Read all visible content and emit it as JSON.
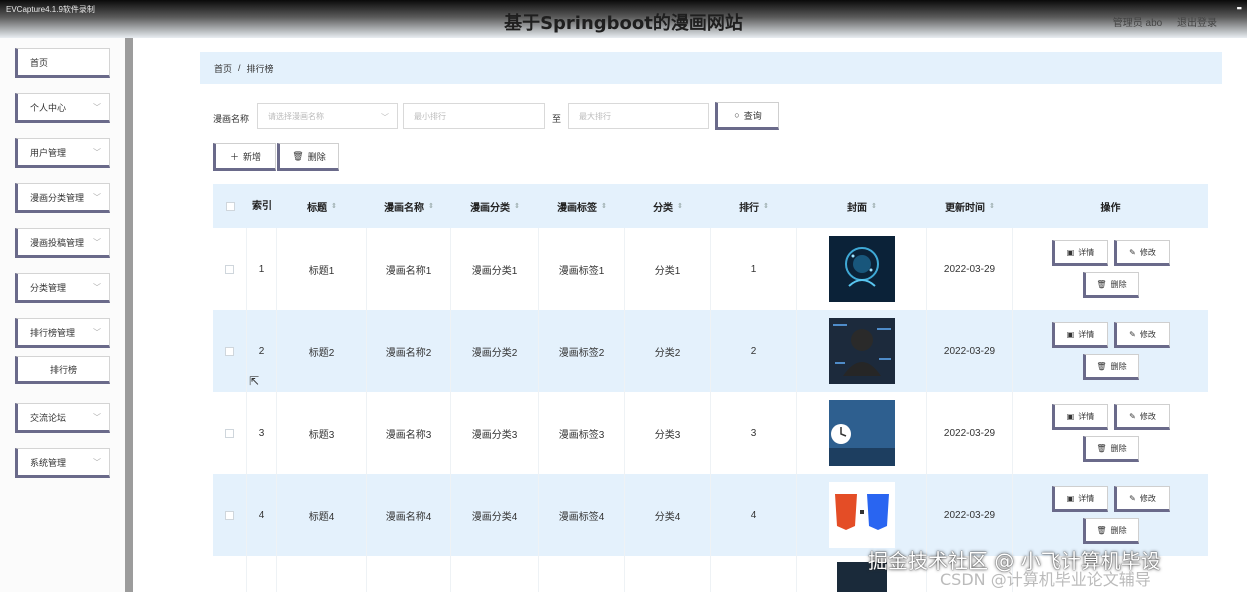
{
  "recording_label": "EVCapture4.1.9软件录制",
  "app": {
    "title": "基于Springboot的漫画网站",
    "user": "管理员 abo",
    "logout": "退出登录"
  },
  "sidebar": {
    "items": [
      {
        "label": "首页",
        "expandable": false
      },
      {
        "label": "个人中心",
        "expandable": true
      },
      {
        "label": "用户管理",
        "expandable": true
      },
      {
        "label": "漫画分类管理",
        "expandable": true
      },
      {
        "label": "漫画投稿管理",
        "expandable": true
      },
      {
        "label": "分类管理",
        "expandable": true
      },
      {
        "label": "排行榜管理",
        "expandable": true
      },
      {
        "label": "交流论坛",
        "expandable": true
      },
      {
        "label": "系统管理",
        "expandable": true
      }
    ],
    "subitem": "排行榜"
  },
  "breadcrumb": {
    "home": "首页",
    "separator": "/",
    "current": "排行榜"
  },
  "search": {
    "label": "漫画名称",
    "name_placeholder": "请选择漫画名称",
    "min_placeholder": "最小排行",
    "to_label": "至",
    "max_placeholder": "最大排行",
    "query_button": "查询"
  },
  "toolbar": {
    "add_button": "新增",
    "delete_button": "删除"
  },
  "table": {
    "headers": {
      "index": "索引",
      "title": "标题",
      "name": "漫画名称",
      "category": "漫画分类",
      "tag": "漫画标签",
      "class": "分类",
      "rank": "排行",
      "cover": "封面",
      "updated": "更新时间",
      "ops": "操作"
    },
    "rows": [
      {
        "index": "1",
        "title": "标题1",
        "name": "漫画名称1",
        "category": "漫画分类1",
        "tag": "漫画标签1",
        "class": "分类1",
        "rank": "1",
        "cover": "ai-brain-cover",
        "updated": "2022-03-29"
      },
      {
        "index": "2",
        "title": "标题2",
        "name": "漫画名称2",
        "category": "漫画分类2",
        "tag": "漫画标签2",
        "class": "分类2",
        "rank": "2",
        "cover": "hacker-cover",
        "updated": "2022-03-29"
      },
      {
        "index": "3",
        "title": "标题3",
        "name": "漫画名称3",
        "category": "漫画分类3",
        "tag": "漫画标签3",
        "class": "分类3",
        "rank": "3",
        "cover": "python-cover",
        "updated": "2022-03-29"
      },
      {
        "index": "4",
        "title": "标题4",
        "name": "漫画名称4",
        "category": "漫画分类4",
        "tag": "漫画标签4",
        "class": "分类4",
        "rank": "4",
        "cover": "html-css-cover",
        "updated": "2022-03-29"
      }
    ],
    "row_actions": {
      "detail": "详情",
      "edit": "修改",
      "delete": "删除"
    }
  },
  "watermark": {
    "line1": "掘金技术社区 @ 小飞计算机毕设",
    "line2": "CSDN @计算机毕业论文辅导"
  },
  "colors": {
    "header_bg": "#e4f1fc",
    "button_accent": "#6a6a8a",
    "alt_row": "#e4f1fc"
  }
}
